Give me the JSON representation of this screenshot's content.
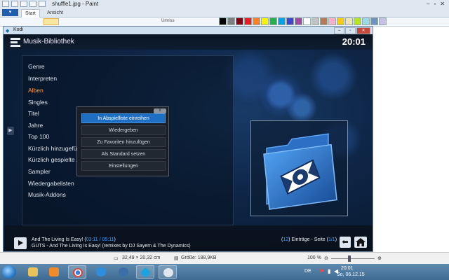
{
  "paint": {
    "title": "shuffle1.jpg - Paint",
    "file_label": "▾",
    "tabs": [
      "Start",
      "Ansicht"
    ],
    "umriss_label": "Umriss",
    "palette": [
      "#000000",
      "#7f7f7f",
      "#880015",
      "#ed1c24",
      "#ff7f27",
      "#fff200",
      "#22b14c",
      "#00a2e8",
      "#3f48cc",
      "#a349a4",
      "#ffffff",
      "#c3c3c3",
      "#b97a57",
      "#ffaec9",
      "#ffc90e",
      "#efe4b0",
      "#b5e61d",
      "#99d9ea",
      "#7092be",
      "#c8bfe7"
    ],
    "status": {
      "dimensions": "32,49 × 20,32 cm",
      "size": "Größe: 188,9KB",
      "zoom": "100 %"
    }
  },
  "kodi": {
    "window_title": "Kodi",
    "header_title": "Musik-Bibliothek",
    "clock": "20:01",
    "menu_items": [
      "Genre",
      "Interpreten",
      "Alben",
      "Singles",
      "Titel",
      "Jahre",
      "Top 100",
      "Kürzlich hinzugefü",
      "Kürzlich gespielte A",
      "Sampler",
      "Wiedergabelisten",
      "Musik-Addons"
    ],
    "active_menu_index": 2,
    "context_menu": [
      "In Abspielliste einreihen",
      "Wiedergeben",
      "Zu Favoriten hinzufügen",
      "Als Standard setzen",
      "Einstellungen"
    ],
    "context_close": "x",
    "now_playing": {
      "line1_prefix": "And The Living Is Easy! (",
      "elapsed": "03:11",
      "separator": " / ",
      "total": "05:11",
      "line1_suffix": ")",
      "line2": "GUTS - And The Living Is Easy! (remixes by DJ Sayem & The Dynamics)"
    },
    "page_info": {
      "open": "(",
      "count": "12",
      "middle": ") Einträge - Seite (",
      "page": "1/1",
      "close": ")"
    }
  },
  "taskbar": {
    "apps": [
      "explorer-icon",
      "media-player-icon",
      "chrome-icon",
      "ie-icon",
      "thunderbird-icon",
      "kodi-icon",
      "paint-icon"
    ],
    "language": "DE",
    "time": "20:01",
    "date": "So, 06.12.15"
  }
}
